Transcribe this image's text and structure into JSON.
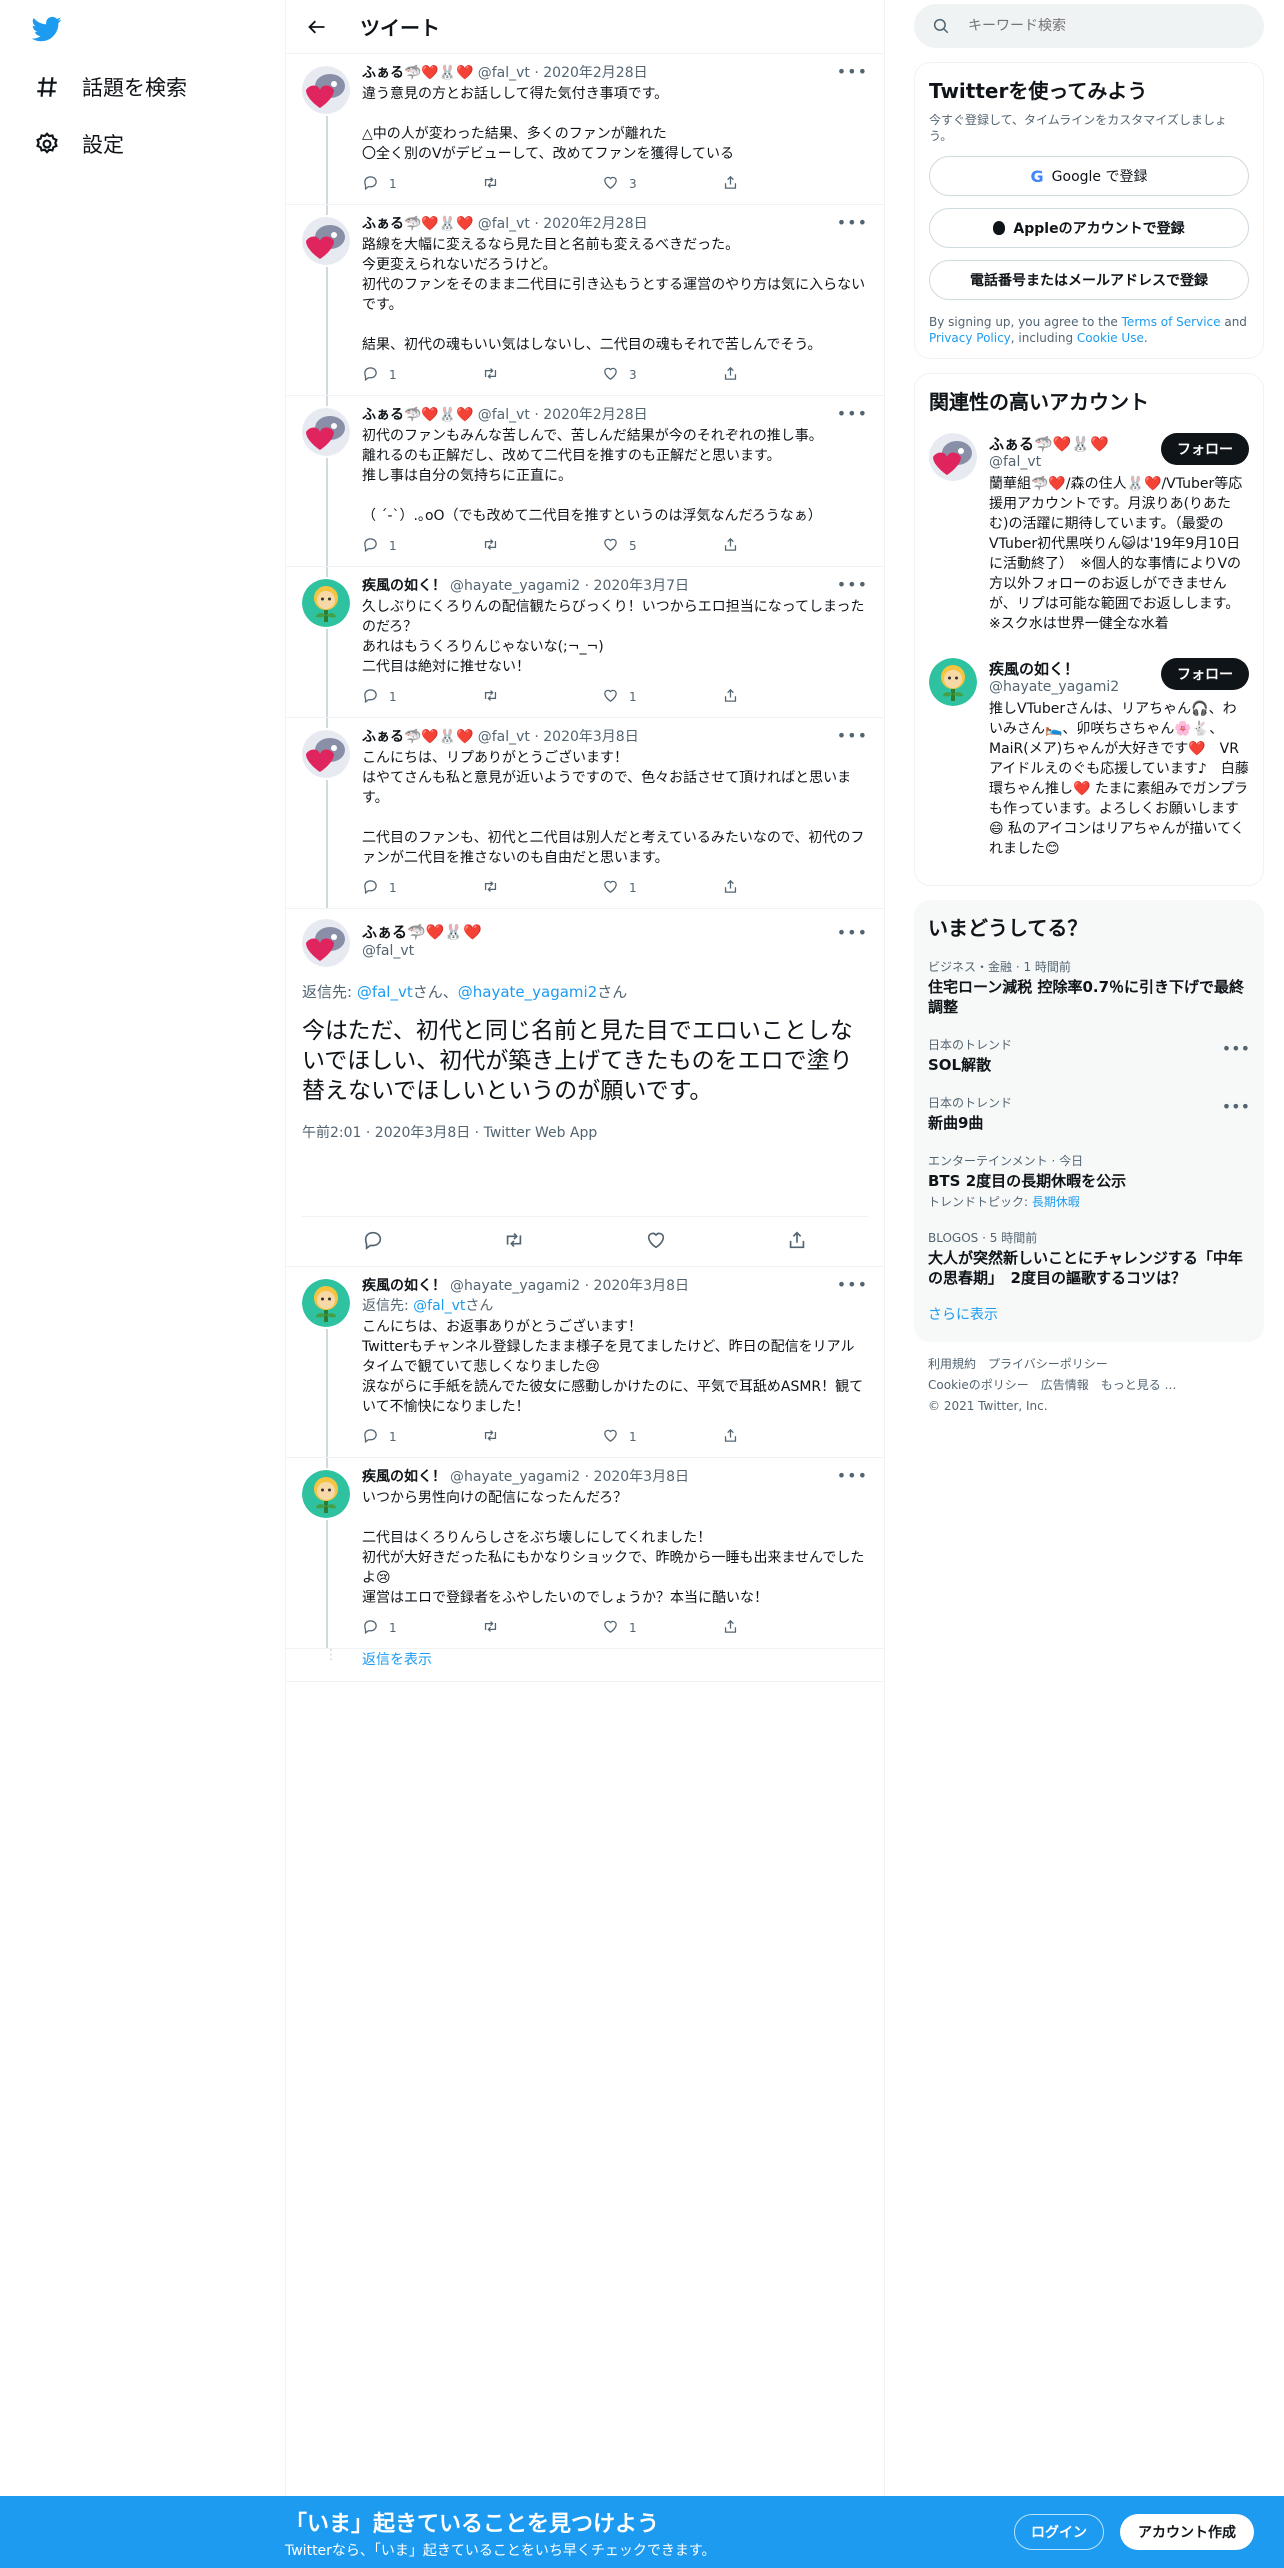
{
  "nav": {
    "explore": "話題を検索",
    "settings": "設定"
  },
  "header": {
    "title": "ツイート"
  },
  "colors": {
    "accent": "#1d9bf0",
    "text": "#0f1419",
    "muted": "#536471"
  },
  "tweets": [
    {
      "name": "ふぁる🦈❤️🐰❤️",
      "handle": "@fal_vt",
      "date": "2020年2月28日",
      "avatar": "fal",
      "text": "違う意見の方とお話しして得た気付き事項です。\n\n△中の人が変わった結果、多くのファンが離れた\n〇全く別のVがデビューして、改めてファンを獲得している",
      "replies": "1",
      "retweets": "",
      "likes": "3"
    },
    {
      "name": "ふぁる🦈❤️🐰❤️",
      "handle": "@fal_vt",
      "date": "2020年2月28日",
      "avatar": "fal",
      "text": "路線を大幅に変えるなら見た目と名前も変えるべきだった。\n今更変えられないだろうけど。\n初代のファンをそのまま二代目に引き込もうとする運営のやり方は気に入らないです。\n\n結果、初代の魂もいい気はしないし、二代目の魂もそれで苦しんでそう。",
      "replies": "1",
      "retweets": "",
      "likes": "3"
    },
    {
      "name": "ふぁる🦈❤️🐰❤️",
      "handle": "@fal_vt",
      "date": "2020年2月28日",
      "avatar": "fal",
      "text": "初代のファンもみんな苦しんで、苦しんだ結果が今のそれぞれの推し事。\n離れるのも正解だし、改めて二代目を推すのも正解だと思います。\n推し事は自分の気持ちに正直に。\n\n（ ´-`）.｡oO（でも改めて二代目を推すというのは浮気なんだろうなぁ）",
      "replies": "1",
      "retweets": "",
      "likes": "5"
    },
    {
      "name": "疾風の如く！",
      "handle": "@hayate_yagami2",
      "date": "2020年3月7日",
      "avatar": "hayate",
      "text": "久しぶりにくろりんの配信観たらびっくり！いつからエロ担当になってしまったのだろ？\nあれはもうくろりんじゃないな(;¬_¬)\n二代目は絶対に推せない！",
      "replies": "1",
      "retweets": "",
      "likes": "1"
    },
    {
      "name": "ふぁる🦈❤️🐰❤️",
      "handle": "@fal_vt",
      "date": "2020年3月8日",
      "avatar": "fal",
      "text": "こんにちは、リプありがとうございます！\nはやてさんも私と意見が近いようですので、色々お話させて頂ければと思います。\n\n二代目のファンも、初代と二代目は別人だと考えているみたいなので、初代のファンが二代目を推さないのも自由だと思います。",
      "replies": "1",
      "retweets": "",
      "likes": "1"
    }
  ],
  "main_tweet": {
    "name": "ふぁる🦈❤️🐰❤️",
    "handle": "@fal_vt",
    "replying_prefix": "返信先: ",
    "replying_1": "@fal_vt",
    "replying_mid": "さん、",
    "replying_2": "@hayate_yagami2",
    "replying_suffix": "さん",
    "text": "今はただ、初代と同じ名前と見た目でエロいことしないでほしい、初代が築き上げてきたものをエロで塗り替えないでほしいというのが願いです。",
    "meta": "午前2:01 · 2020年3月8日 · Twitter Web App"
  },
  "replies": [
    {
      "name": "疾風の如く！",
      "handle": "@hayate_yagami2",
      "date": "2020年3月8日",
      "avatar": "hayate",
      "replying_prefix": "返信先: ",
      "replying_to": "@fal_vt",
      "replying_suffix": "さん",
      "text": "こんにちは、お返事ありがとうございます！\nTwitterもチャンネル登録したまま様子を見てましたけど、昨日の配信をリアルタイムで観ていて悲しくなりました😢\n涙ながらに手紙を読んでた彼女に感動しかけたのに、平気で耳舐めASMR！観ていて不愉快になりました！",
      "replies": "1",
      "retweets": "",
      "likes": "1"
    },
    {
      "name": "疾風の如く！",
      "handle": "@hayate_yagami2",
      "date": "2020年3月8日",
      "avatar": "hayate",
      "text": "いつから男性向けの配信になったんだろ？\n\n二代目はくろりんらしさをぶち壊しにしてくれました！\n初代が大好きだった私にもかなりショックで、昨晩から一睡も出来ませんでしたよ😢\n運営はエロで登録者をふやしたいのでしょうか？本当に酷いな！",
      "replies": "1",
      "retweets": "",
      "likes": "1"
    }
  ],
  "show_replies": "返信を表示",
  "search": {
    "placeholder": "キーワード検索"
  },
  "signup_card": {
    "title": "Twitterを使ってみよう",
    "subtitle": "今すぐ登録して、タイムラインをカスタマイズしましょう。",
    "google": "Google で登録",
    "apple": "Appleのアカウントで登録",
    "phone": "電話番号またはメールアドレスで登録",
    "legal_1": "By signing up, you agree to the ",
    "terms": "Terms of Service",
    "legal_2": " and ",
    "privacy": "Privacy Policy",
    "legal_3": ", including ",
    "cookie": "Cookie Use",
    "legal_4": "."
  },
  "related": {
    "title": "関連性の高いアカウント",
    "follow_label": "フォロー",
    "accounts": [
      {
        "name": "ふぁる🦈❤️🐰❤️",
        "handle": "@fal_vt",
        "bio": "蘭華組🦈❤️/森の住人🐰❤️/VTuber等応援用アカウントです。月涙りあ(りあたむ)の活躍に期待しています。（最愛のVTuber初代黒咲りん😺は'19年9月10日に活動終了）　※個人的な事情によりVの方以外フォローのお返しができませんが、リプは可能な範囲でお返しします。※スク水は世界一健全な水着"
      },
      {
        "name": "疾風の如く！",
        "handle": "@hayate_yagami2",
        "bio": "推しVTuberさんは、リアちゃん🎧、わいみさん🛌、卯咲ちさちゃん🌸🐇、MaiR(メア)ちゃんが大好きです❤️　VRアイドルえのぐも応援しています♪　白藤　環ちゃん推し❤️ たまに素組みでガンプラも作っています。よろしくお願いします😄 私のアイコンはリアちゃんが描いてくれました😊"
      }
    ]
  },
  "trends": {
    "title": "いまどうしてる？",
    "items": [
      {
        "context": "ビジネス・金融 · 1 時間前",
        "title": "住宅ローン減税 控除率0.7％に引き下げで最終調整",
        "sub": "",
        "dots": false
      },
      {
        "context": "日本のトレンド",
        "title": "SOL解散",
        "sub": "",
        "dots": true
      },
      {
        "context": "日本のトレンド",
        "title": "新曲9曲",
        "sub": "",
        "dots": true
      },
      {
        "context": "エンターテインメント · 今日",
        "title": "BTS 2度目の長期休暇を公示",
        "sub_prefix": "トレンドトピック: ",
        "sub_link": "長期休暇",
        "dots": false
      },
      {
        "context": "BLOGOS · 5 時間前",
        "title": "大人が突然新しいことにチャレンジする「中年の思春期」　2度目の謳歌するコツは？",
        "sub": "",
        "dots": false
      }
    ],
    "show_more": "さらに表示"
  },
  "footer": {
    "line1": "利用規約　プライバシーポリシー",
    "line2": "Cookieのポリシー　広告情報　もっと見る …",
    "copyright": "© 2021 Twitter, Inc."
  },
  "bottom_bar": {
    "headline": "「いま」起きていることを見つけよう",
    "sub": "Twitterなら、「いま」起きていることをいち早くチェックできます。",
    "login": "ログイン",
    "signup": "アカウント作成"
  }
}
